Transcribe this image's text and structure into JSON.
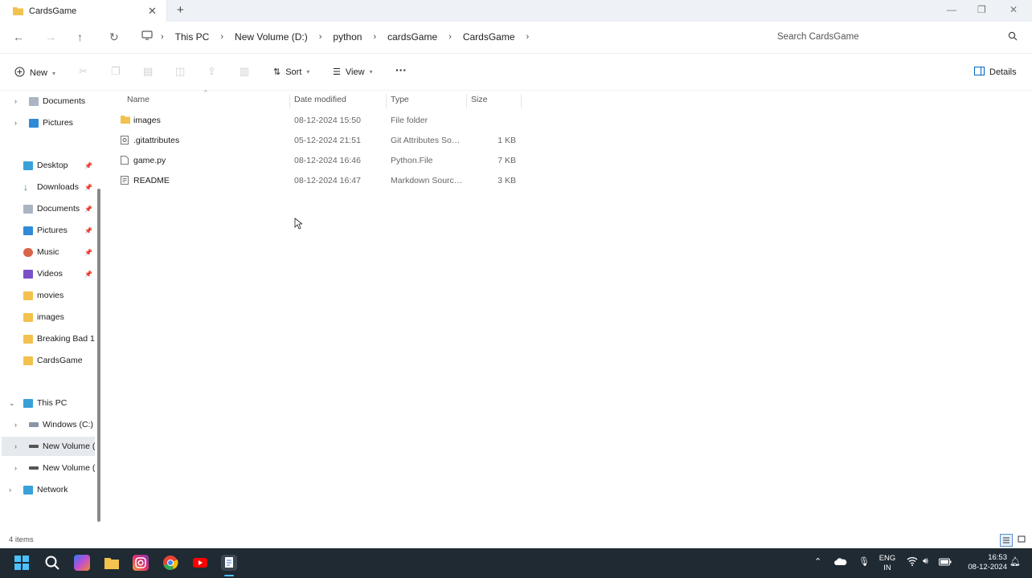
{
  "tab": {
    "title": "CardsGame",
    "close": "✕",
    "new": "+"
  },
  "window_controls": {
    "minimize": "—",
    "restore": "❐",
    "close": "✕"
  },
  "breadcrumbs": [
    "This PC",
    "New Volume (D:)",
    "python",
    "cardsGame",
    "CardsGame"
  ],
  "search": {
    "placeholder": "Search CardsGame"
  },
  "command_bar": {
    "new": "New",
    "sort": "Sort",
    "view": "View",
    "more": "···",
    "details": "Details"
  },
  "sidebar": {
    "items": [
      {
        "label": "Documents",
        "icon": "documents-icon"
      },
      {
        "label": "Pictures",
        "icon": "pictures-icon"
      },
      {
        "label": "Desktop",
        "icon": "desktop-icon"
      },
      {
        "label": "Downloads",
        "icon": "downloads-icon"
      },
      {
        "label": "Documents",
        "icon": "documents-icon"
      },
      {
        "label": "Pictures",
        "icon": "pictures-icon"
      },
      {
        "label": "Music",
        "icon": "music-icon"
      },
      {
        "label": "Videos",
        "icon": "videos-icon"
      },
      {
        "label": "movies",
        "icon": "folder-icon"
      },
      {
        "label": "images",
        "icon": "folder-icon"
      },
      {
        "label": "Breaking Bad 1",
        "icon": "folder-icon"
      },
      {
        "label": "CardsGame",
        "icon": "folder-icon"
      },
      {
        "label": "This PC",
        "icon": "this-pc-icon"
      },
      {
        "label": "Windows (C:)",
        "icon": "drive-icon"
      },
      {
        "label": "New Volume (I",
        "icon": "drive-icon"
      },
      {
        "label": "New Volume (I",
        "icon": "drive-icon"
      },
      {
        "label": "Network",
        "icon": "network-icon"
      }
    ]
  },
  "columns": {
    "name": "Name",
    "date": "Date modified",
    "type": "Type",
    "size": "Size"
  },
  "files": [
    {
      "name": "images",
      "date": "08-12-2024 15:50",
      "type": "File folder",
      "size": "",
      "icon": "folder-icon"
    },
    {
      "name": ".gitattributes",
      "date": "05-12-2024 21:51",
      "type": "Git Attributes Sour...",
      "size": "1 KB",
      "icon": "settings-file-icon"
    },
    {
      "name": "game.py",
      "date": "08-12-2024 16:46",
      "type": "Python.File",
      "size": "7 KB",
      "icon": "file-icon"
    },
    {
      "name": "README",
      "date": "08-12-2024 16:47",
      "type": "Markdown Source ...",
      "size": "3 KB",
      "icon": "markdown-file-icon"
    }
  ],
  "status": {
    "count": "4 items"
  },
  "tray": {
    "lang_line1": "ENG",
    "lang_line2": "IN",
    "time": "16:53",
    "date": "08-12-2024"
  },
  "colors": {
    "folder": "#f2c14e",
    "accent": "#0067c0",
    "taskbar": "#1f2a33"
  }
}
